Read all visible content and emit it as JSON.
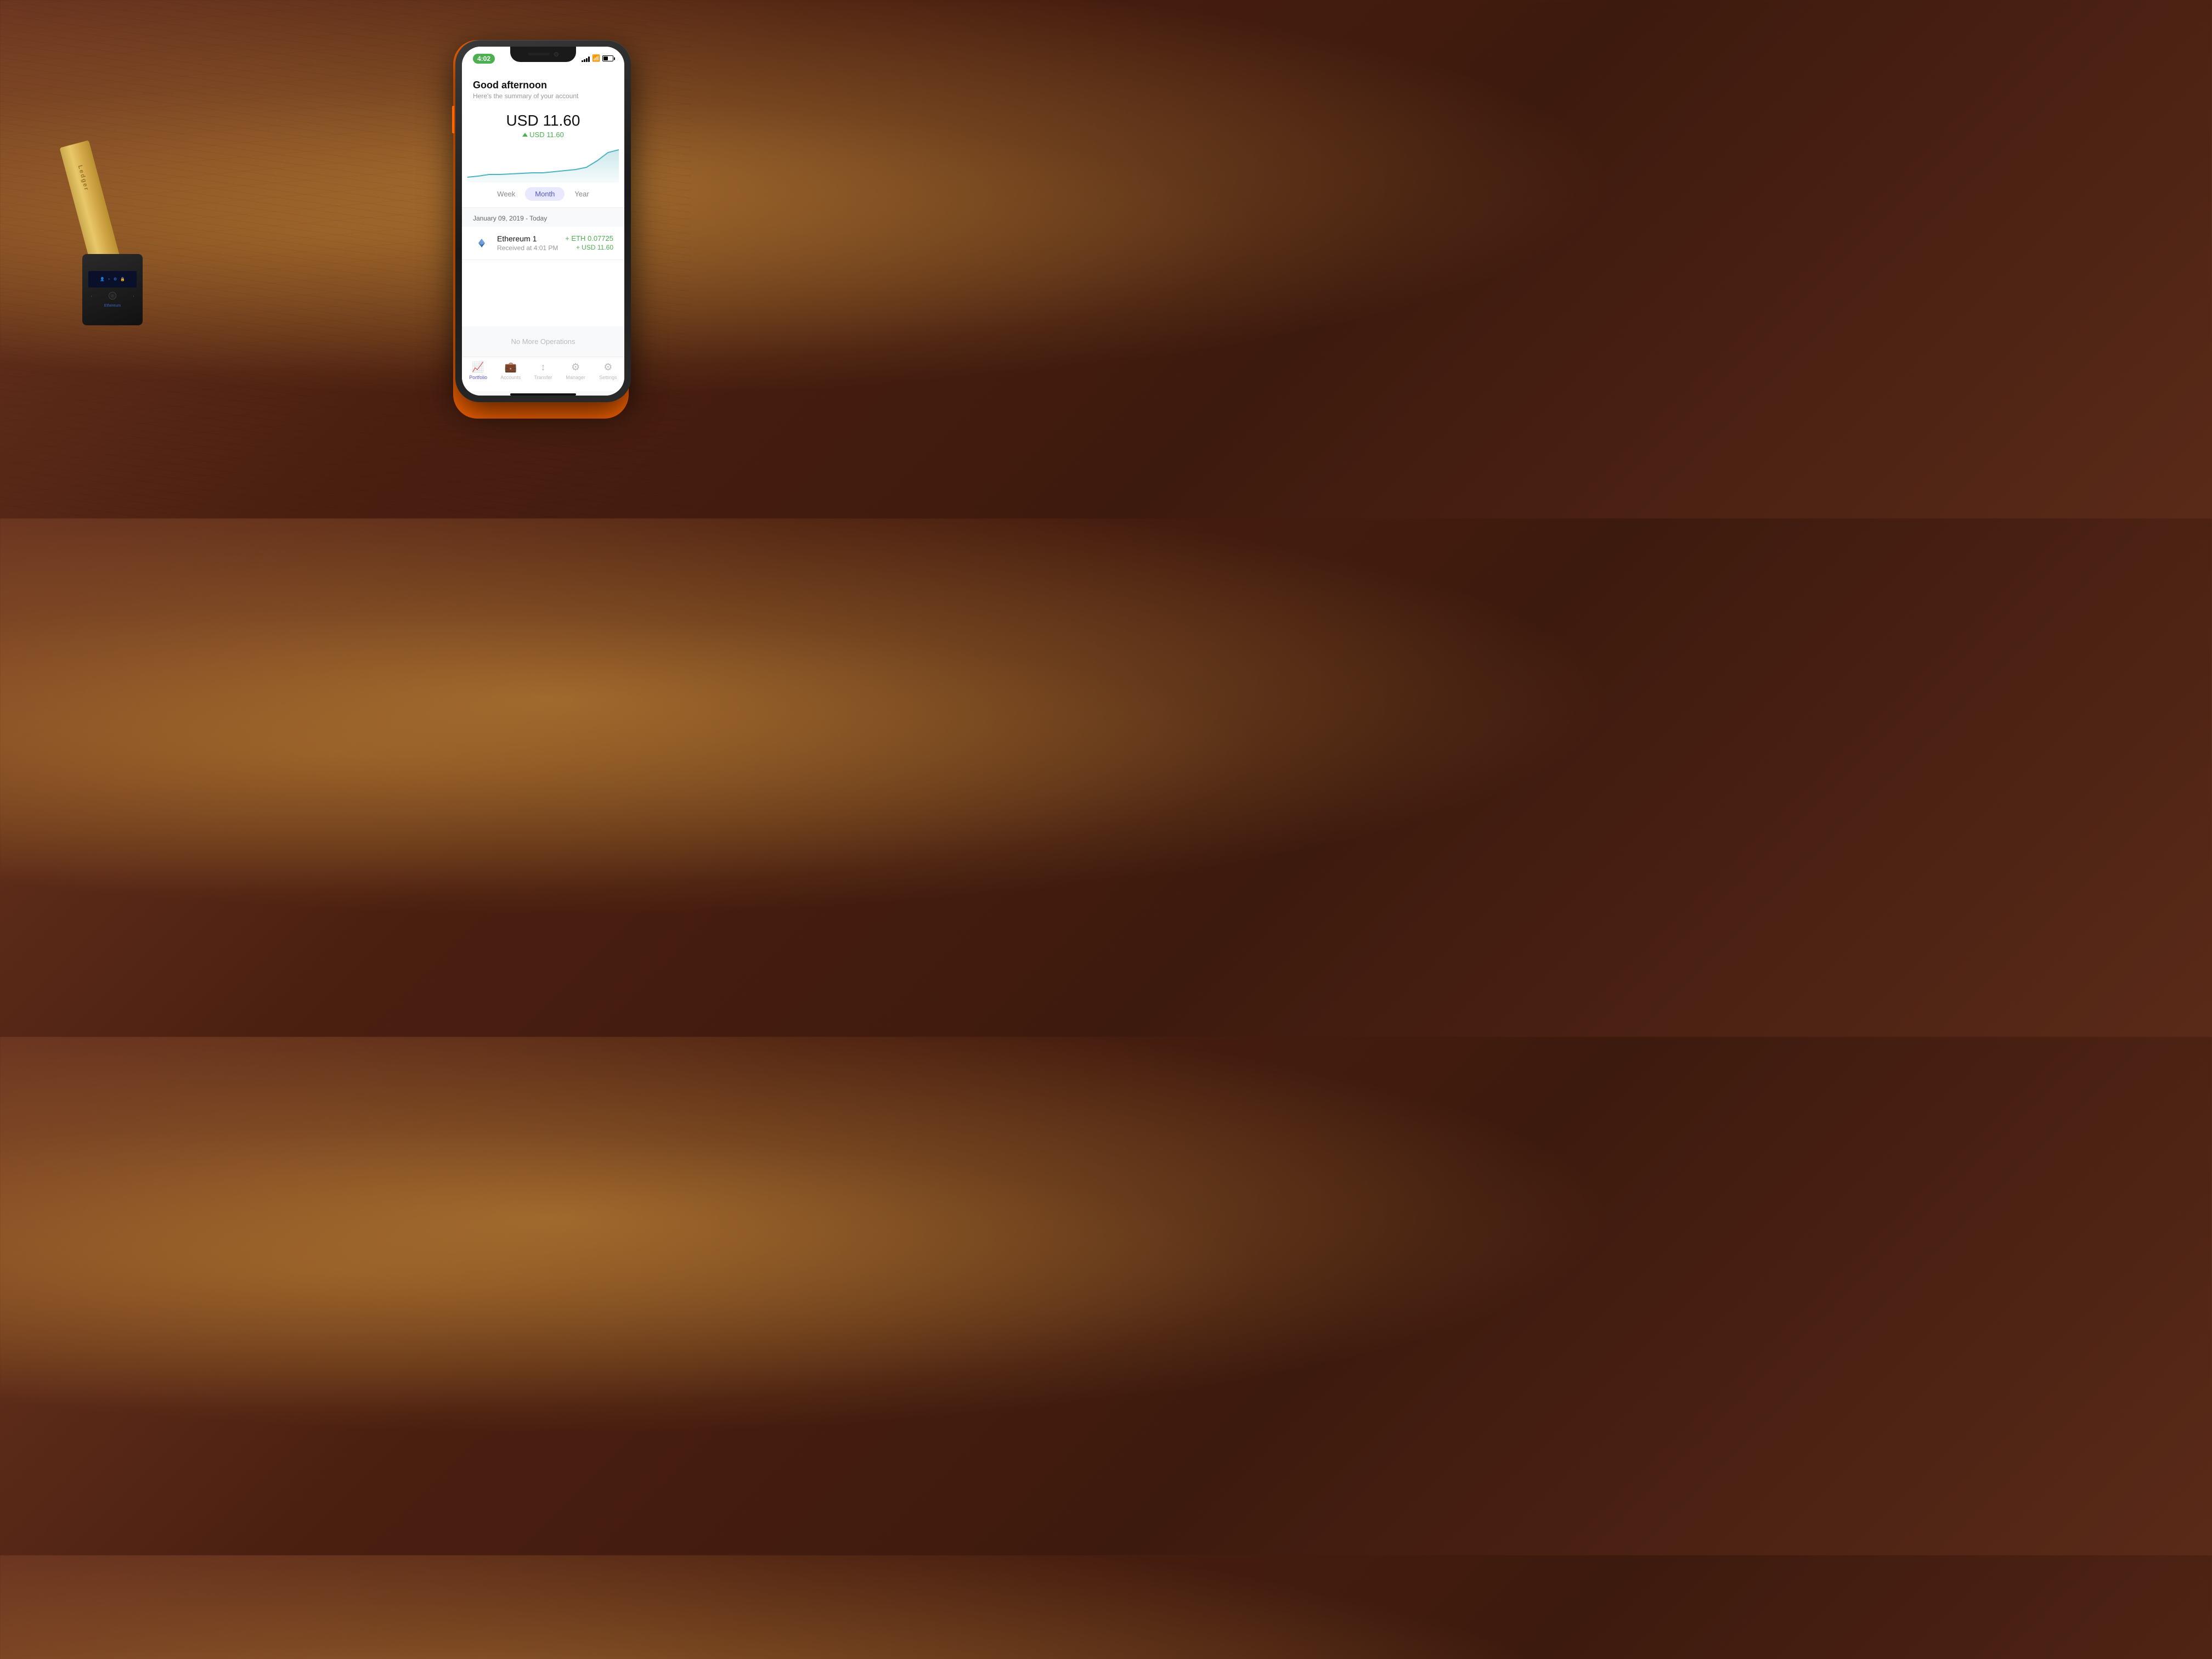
{
  "status_bar": {
    "time": "4:02",
    "signal_bars": [
      3,
      6,
      9,
      12,
      12
    ],
    "battery_pct": 50
  },
  "header": {
    "greeting": "Good afternoon",
    "subtitle": "Here's the summary of your account"
  },
  "balance": {
    "amount": "USD 11.60",
    "change": "USD 11.60"
  },
  "chart": {
    "color": "#4fb3bf"
  },
  "period_selector": {
    "options": [
      "Week",
      "Month",
      "Year"
    ],
    "active": "Month"
  },
  "date_range": "January 09, 2019 - Today",
  "operations": [
    {
      "name": "Ethereum 1",
      "time": "Received at 4:01 PM",
      "crypto": "+ ETH 0.07725",
      "fiat": "+ USD 11.60"
    }
  ],
  "no_more_label": "No More Operations",
  "bottom_nav": [
    {
      "id": "portfolio",
      "label": "Portfolio",
      "active": true
    },
    {
      "id": "accounts",
      "label": "Accounts",
      "active": false
    },
    {
      "id": "transfer",
      "label": "Transfer",
      "active": false
    },
    {
      "id": "manager",
      "label": "Manager",
      "active": false
    },
    {
      "id": "settings",
      "label": "Settings",
      "active": false
    }
  ],
  "ledger": {
    "brand": "Ledger",
    "eth_label": "Ethereum"
  }
}
